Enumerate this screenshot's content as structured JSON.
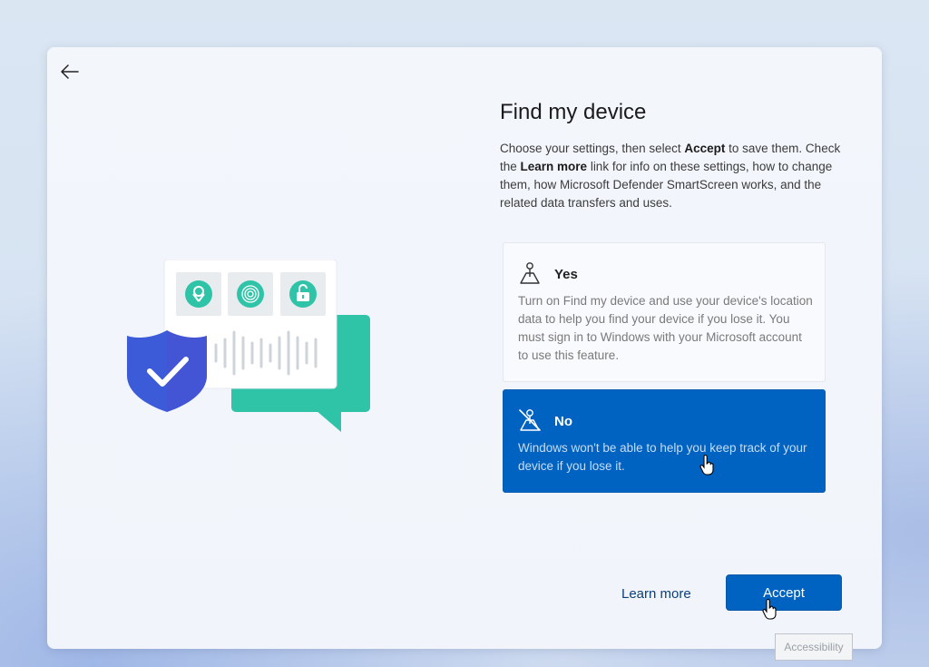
{
  "page": {
    "title": "Find my device",
    "description": {
      "p1": "Choose your settings, then select ",
      "accept_word": "Accept",
      "p2": " to save them. Check the ",
      "learn_word": "Learn more",
      "p3": " link for info on these settings, how to change them, how Microsoft Defender SmartScreen works, and the related data transfers and uses."
    }
  },
  "options": {
    "yes": {
      "label": "Yes",
      "description": "Turn on Find my device and use your device's location data to help you find your device if you lose it. You must sign in to Windows with your Microsoft account to use this feature.",
      "icon": "location-person-icon"
    },
    "no": {
      "label": "No",
      "description": "Windows won't be able to help you keep track of your device if you lose it.",
      "icon": "location-off-icon",
      "selected": true
    }
  },
  "footer": {
    "learn_more": "Learn more",
    "accept": "Accept"
  },
  "accessibility": "Accessibility",
  "colors": {
    "accent": "#0063c1",
    "shield": "#3b5bd9",
    "bubble": "#2fc3a8"
  }
}
